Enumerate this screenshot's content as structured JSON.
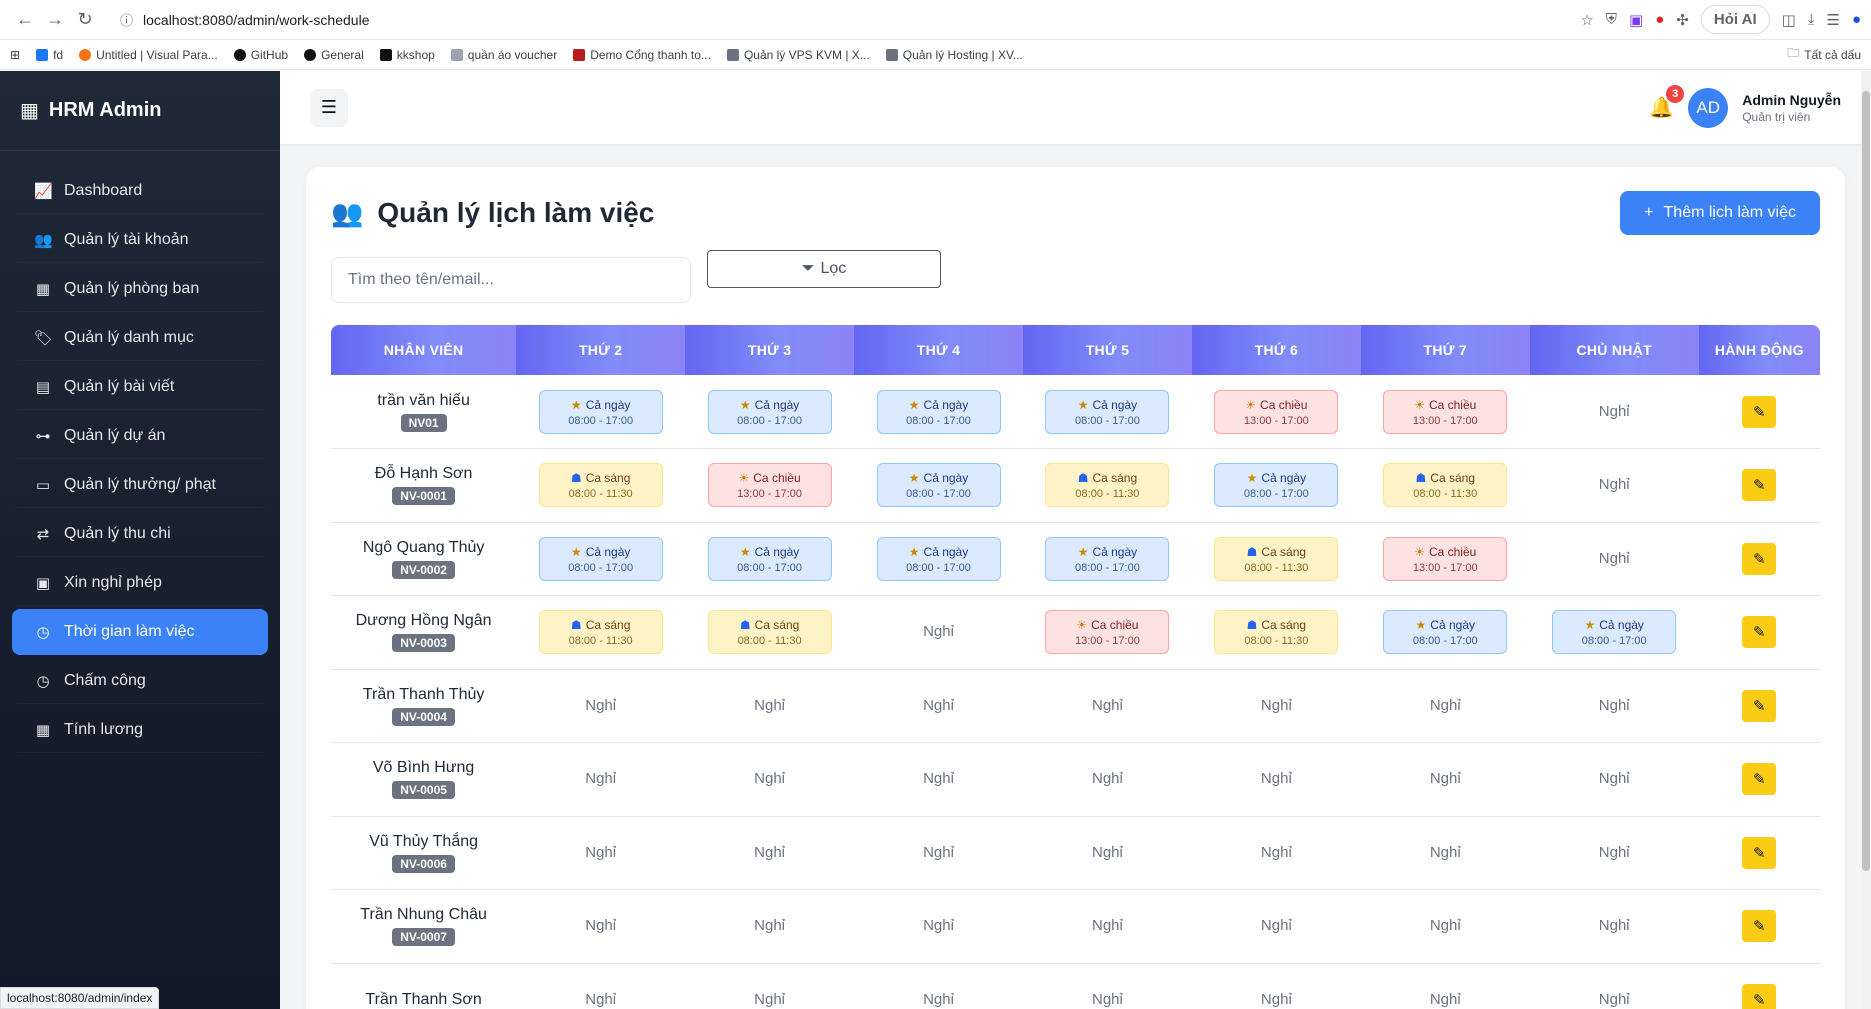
{
  "browser": {
    "url": "localhost:8080/admin/work-schedule",
    "ask_ai": "Hỏi AI",
    "bookmarks": [
      "fd",
      "Untitled | Visual Para...",
      "GitHub",
      "General",
      "kkshop",
      "quần áo voucher",
      "Demo Cổng thanh to...",
      "Quản lý VPS KVM | X...",
      "Quản lý Hosting | XV..."
    ],
    "bookmarks_right": "Tất cả dấu",
    "status_url": "localhost:8080/admin/index"
  },
  "sidebar": {
    "brand": "HRM Admin",
    "items": [
      {
        "label": "Dashboard",
        "icon": "chart-line-icon"
      },
      {
        "label": "Quản lý tài khoản",
        "icon": "users-icon"
      },
      {
        "label": "Quản lý phòng ban",
        "icon": "building-icon"
      },
      {
        "label": "Quản lý danh mục",
        "icon": "tags-icon"
      },
      {
        "label": "Quản lý bài viết",
        "icon": "newspaper-icon"
      },
      {
        "label": "Quản lý dự án",
        "icon": "project-diagram-icon"
      },
      {
        "label": "Quản lý thưởng/ phạt",
        "icon": "money-icon"
      },
      {
        "label": "Quản lý thu chi",
        "icon": "exchange-icon"
      },
      {
        "label": "Xin nghỉ phép",
        "icon": "calendar-icon"
      },
      {
        "label": "Thời gian làm việc",
        "icon": "clock-icon",
        "active": true
      },
      {
        "label": "Chấm công",
        "icon": "clock-icon"
      },
      {
        "label": "Tính lương",
        "icon": "calculator-icon"
      }
    ]
  },
  "topbar": {
    "notification_count": "3",
    "avatar_initials": "AD",
    "user_name": "Admin Nguyễn",
    "user_role": "Quản trị viên"
  },
  "page": {
    "title": "Quản lý lịch làm việc",
    "add_button": "Thêm lịch làm việc",
    "search_placeholder": "Tìm theo tên/email...",
    "filter_button": "Lọc"
  },
  "table": {
    "columns": [
      "NHÂN VIÊN",
      "THỨ 2",
      "THỨ 3",
      "THỨ 4",
      "THỨ 5",
      "THỨ 6",
      "THỨ 7",
      "CHỦ NHẬT",
      "HÀNH ĐỘNG"
    ],
    "shift_types": {
      "full": {
        "label": "Cả ngày",
        "time": "08:00 - 17:00",
        "icon": "star-icon"
      },
      "morning": {
        "label": "Ca sáng",
        "time": "08:00 - 11:30",
        "icon": "sunrise-icon"
      },
      "afternoon": {
        "label": "Ca chiều",
        "time": "13:00 - 17:00",
        "icon": "sun-icon"
      }
    },
    "off_label": "Nghỉ",
    "rows": [
      {
        "name": "trần văn hiếu",
        "code": "NV01",
        "days": [
          "full",
          "full",
          "full",
          "full",
          "afternoon",
          "afternoon",
          "off"
        ]
      },
      {
        "name": "Đỗ Hạnh Sơn",
        "code": "NV-0001",
        "days": [
          "morning",
          "afternoon",
          "full",
          "morning",
          "full",
          "morning",
          "off"
        ]
      },
      {
        "name": "Ngô Quang Thủy",
        "code": "NV-0002",
        "days": [
          "full",
          "full",
          "full",
          "full",
          "morning",
          "afternoon",
          "off"
        ]
      },
      {
        "name": "Dương Hồng Ngân",
        "code": "NV-0003",
        "days": [
          "morning",
          "morning",
          "off",
          "afternoon",
          "morning",
          "full",
          "full"
        ]
      },
      {
        "name": "Trần Thanh Thủy",
        "code": "NV-0004",
        "days": [
          "off",
          "off",
          "off",
          "off",
          "off",
          "off",
          "off"
        ]
      },
      {
        "name": "Võ Bình Hưng",
        "code": "NV-0005",
        "days": [
          "off",
          "off",
          "off",
          "off",
          "off",
          "off",
          "off"
        ]
      },
      {
        "name": "Vũ Thủy Thắng",
        "code": "NV-0006",
        "days": [
          "off",
          "off",
          "off",
          "off",
          "off",
          "off",
          "off"
        ]
      },
      {
        "name": "Trần Nhung Châu",
        "code": "NV-0007",
        "days": [
          "off",
          "off",
          "off",
          "off",
          "off",
          "off",
          "off"
        ]
      },
      {
        "name": "Trần Thanh Sơn",
        "code": "",
        "days": [
          "off",
          "off",
          "off",
          "off",
          "off",
          "off",
          "off"
        ]
      }
    ]
  }
}
